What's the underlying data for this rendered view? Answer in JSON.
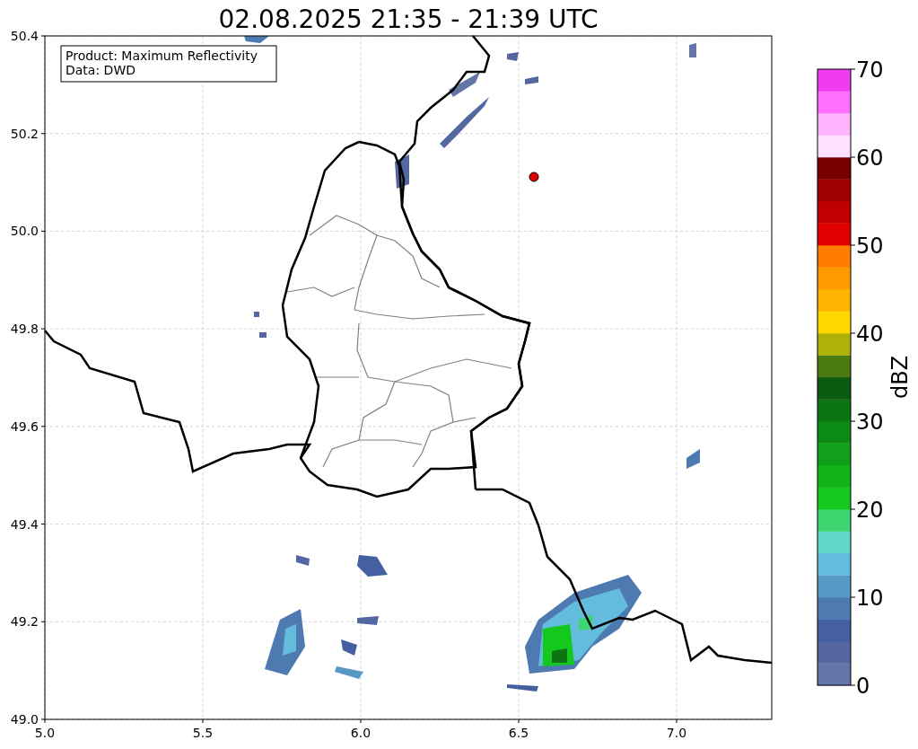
{
  "title": "02.08.2025 21:35 - 21:39 UTC",
  "info_box": {
    "lines": [
      "Product: Maximum Reflectivity",
      "Data: DWD"
    ]
  },
  "map": {
    "x_ticks": [
      "5.0",
      "5.5",
      "6.0",
      "6.5",
      "7.0"
    ],
    "y_ticks": [
      "50.4",
      "50.2",
      "50.0",
      "49.8",
      "49.6",
      "49.4",
      "49.2",
      "49.0"
    ]
  },
  "colorbar": {
    "label": "dBZ",
    "ticks": [
      "70",
      "60",
      "50",
      "40",
      "30",
      "20",
      "10",
      "0"
    ],
    "bins": [
      {
        "color": "#6476a8"
      },
      {
        "color": "#5567a0"
      },
      {
        "color": "#4560a0"
      },
      {
        "color": "#4d7ab0"
      },
      {
        "color": "#5898c4"
      },
      {
        "color": "#64bcdc"
      },
      {
        "color": "#64d8c8"
      },
      {
        "color": "#3ed470"
      },
      {
        "color": "#14c81e"
      },
      {
        "color": "#10b41a"
      },
      {
        "color": "#10a01a"
      },
      {
        "color": "#0c8a16"
      },
      {
        "color": "#0c7412"
      },
      {
        "color": "#0a5c10"
      },
      {
        "color": "#4a7a10"
      },
      {
        "color": "#b0b00a"
      },
      {
        "color": "#ffd800"
      },
      {
        "color": "#ffb400"
      },
      {
        "color": "#ff9a00"
      },
      {
        "color": "#ff7c00"
      },
      {
        "color": "#e00000"
      },
      {
        "color": "#c00000"
      },
      {
        "color": "#a00000"
      },
      {
        "color": "#780000"
      },
      {
        "color": "#ffe0ff"
      },
      {
        "color": "#ffb4ff"
      },
      {
        "color": "#ff70ff"
      },
      {
        "color": "#f03cf0"
      }
    ]
  }
}
